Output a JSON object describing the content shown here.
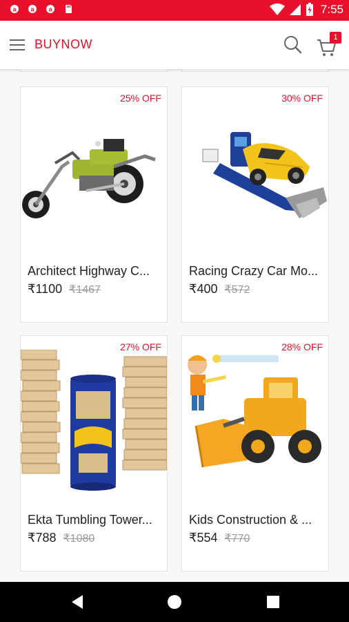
{
  "status_bar": {
    "time": "7:55",
    "notification_icons": [
      "app-notification-icon",
      "app-notification-icon",
      "app-notification-icon",
      "sd-card-icon"
    ],
    "status_icons": [
      "wifi-icon",
      "signal-icon",
      "battery-icon"
    ]
  },
  "app_bar": {
    "title": "BUYNOW",
    "cart_count": "1",
    "icons": [
      "menu-icon",
      "search-icon",
      "cart-icon"
    ]
  },
  "products": [
    {
      "name": "Architect Highway C...",
      "price": "₹1100",
      "old_price": "₹1467",
      "discount": "25% OFF",
      "image": "motorcycle-toy"
    },
    {
      "name": "Racing Crazy Car Mo...",
      "price": "₹400",
      "old_price": "₹572",
      "discount": "30% OFF",
      "image": "race-car-launcher-toy"
    },
    {
      "name": "Ekta Tumbling Tower...",
      "price": "₹788",
      "old_price": "₹1080",
      "discount": "27% OFF",
      "image": "tumbling-tower-game"
    },
    {
      "name": "Kids Construction & ...",
      "price": "₹554",
      "old_price": "₹770",
      "discount": "28% OFF",
      "image": "construction-loader-toy"
    }
  ],
  "nav_bar": {
    "buttons": [
      "back-icon",
      "home-icon",
      "recents-icon"
    ]
  },
  "colors": {
    "accent": "#e8102a",
    "text": "#222222",
    "muted": "#9a9a9a"
  }
}
